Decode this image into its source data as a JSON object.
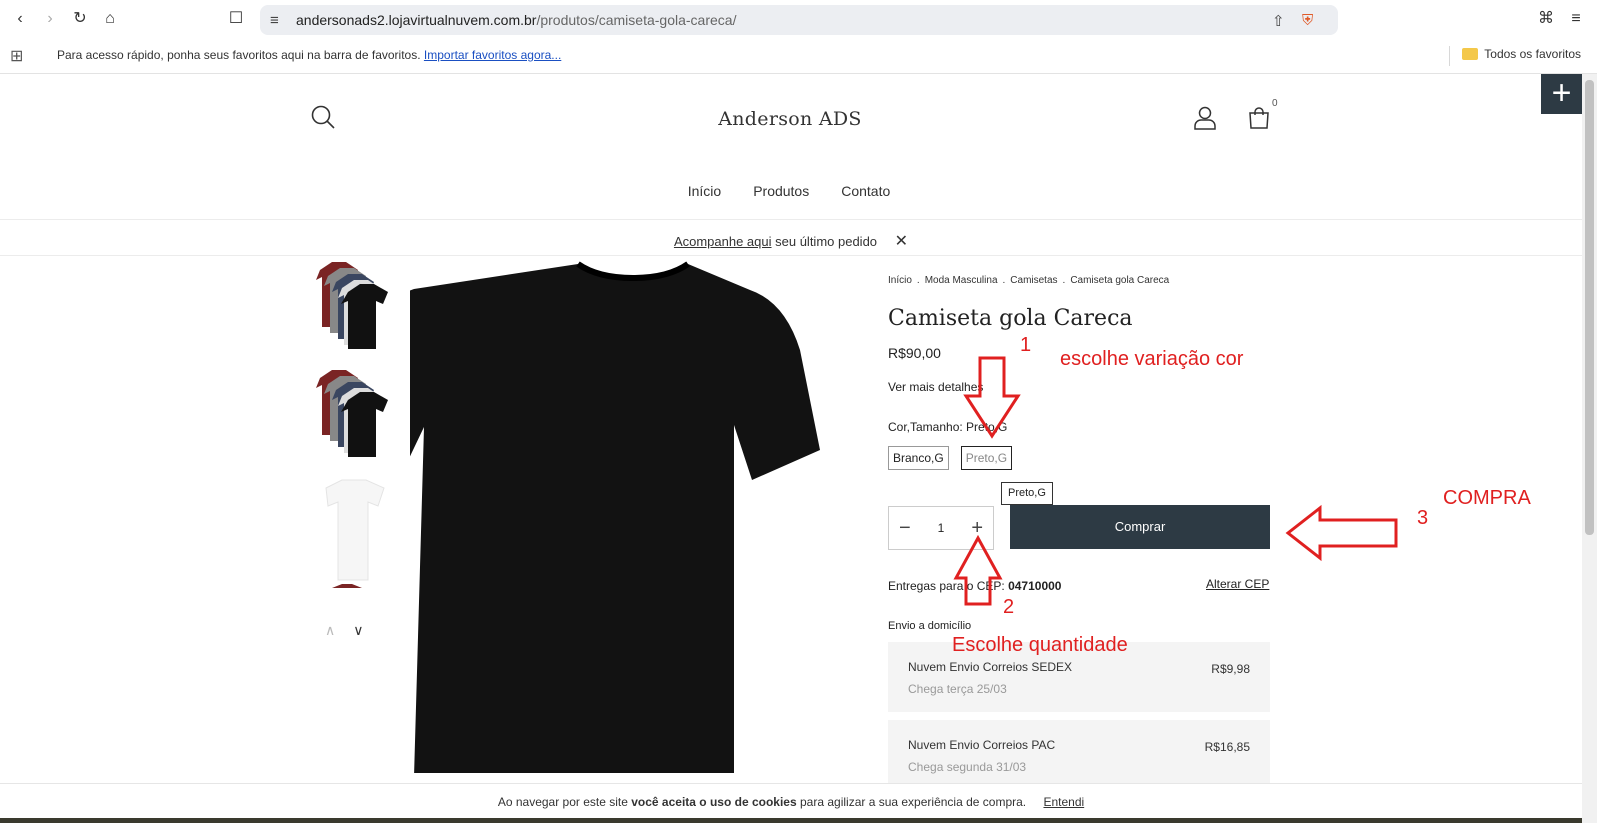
{
  "browser": {
    "url_host": "andersonads2.lojavirtualnuvem.com.br",
    "url_path": "/produtos/camiseta-gola-careca/",
    "bookmarks_hint": "Para acesso rápido, ponha seus favoritos aqui na barra de favoritos.",
    "bookmarks_import": "Importar favoritos agora...",
    "all_favorites": "Todos os favoritos"
  },
  "store": {
    "name": "Anderson ADS",
    "cart_count": "0",
    "nav": [
      "Início",
      "Produtos",
      "Contato"
    ],
    "order_track_link": "Acompanhe aqui",
    "order_track_text": " seu último pedido"
  },
  "breadcrumb": [
    "Início",
    ".",
    "Moda Masculina",
    ".",
    "Camisetas",
    ".",
    "Camiseta gola Careca"
  ],
  "product": {
    "title": "Camiseta gola Careca",
    "price": "R$90,00",
    "more_details": "Ver mais detalhes",
    "variant_label": "Cor,Tamanho: Preto,G",
    "variants": [
      "Branco,G",
      "Preto,G"
    ],
    "selected_variant": "Preto,G",
    "tooltip": "Preto,G",
    "quantity": "1",
    "buy_label": "Comprar"
  },
  "shipping": {
    "cep_label": "Entregas para o CEP: ",
    "cep": "04710000",
    "change_cep": "Alterar CEP",
    "home_delivery": "Envio a domicílio",
    "options": [
      {
        "name": "Nuvem Envio Correios SEDEX",
        "date": "Chega terça 25/03",
        "price": "R$9,98"
      },
      {
        "name": "Nuvem Envio Correios PAC",
        "date": "Chega segunda 31/03",
        "price": "R$16,85"
      }
    ]
  },
  "annotations": {
    "n1": "1",
    "t1": "escolhe variação cor",
    "n2": "2",
    "t2": "Escolhe quantidade",
    "n3": "3",
    "t3": "COMPRA"
  },
  "cookie": {
    "pre": "Ao navegar por este site ",
    "bold": "você aceita o uso de cookies",
    "post": " para agilizar a sua experiência de compra.",
    "accept": "Entendi"
  },
  "colors": {
    "primary_button": "#2d3a44",
    "annotation": "#e02020"
  }
}
